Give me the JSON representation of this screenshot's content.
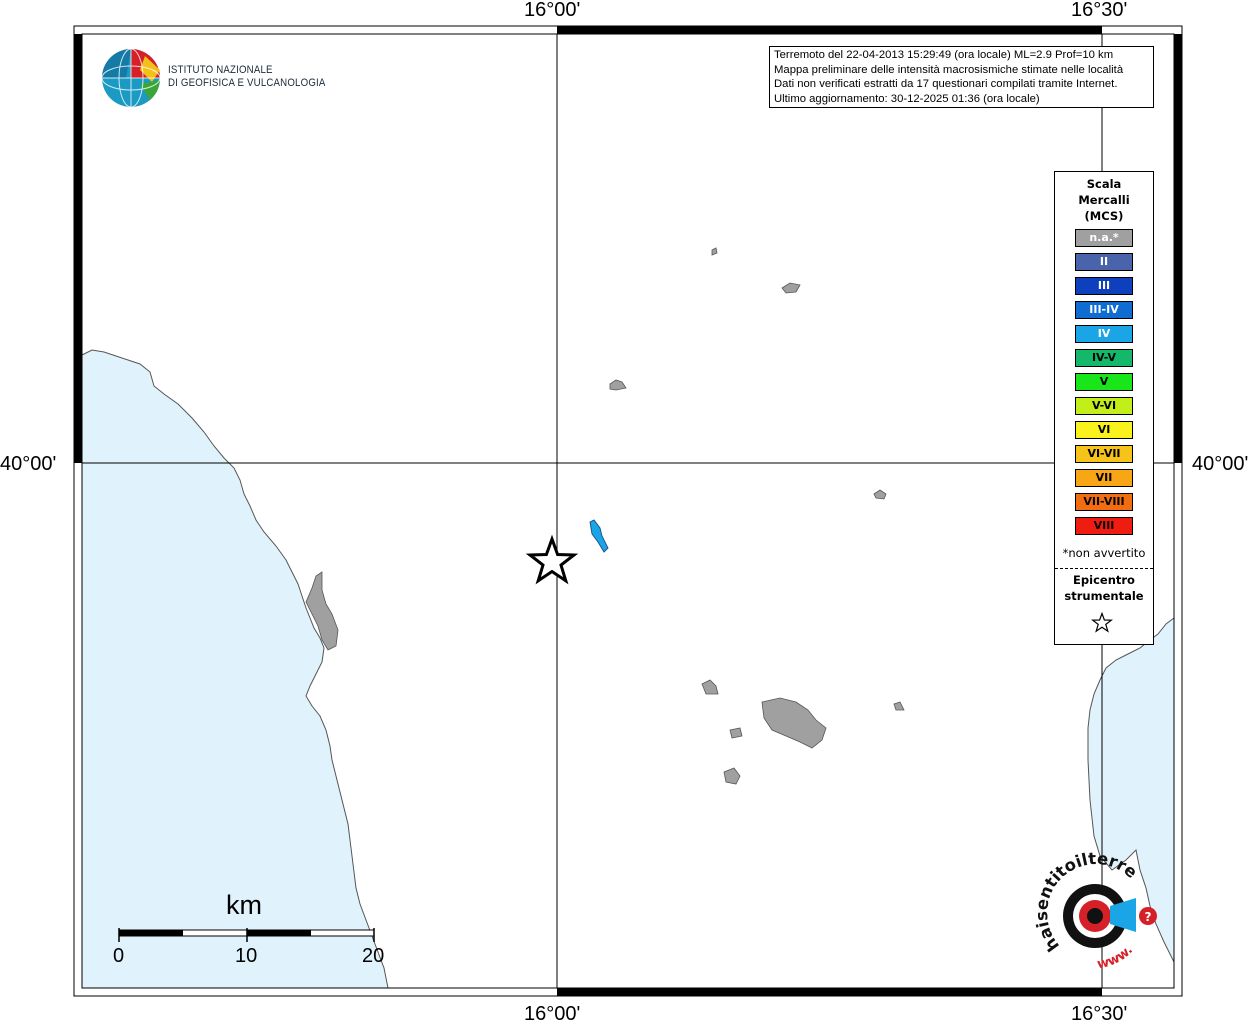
{
  "map": {
    "graticule": {
      "lon_labels": [
        "16°00'",
        "16°30'"
      ],
      "lat_labels": [
        "40°00'"
      ]
    },
    "colors": {
      "sea": "#e0f3fc",
      "land_felt": "#a0a0a0",
      "coast": "#444444",
      "frame": "#000000"
    }
  },
  "info": {
    "lines": [
      "Terremoto del 22-04-2013 15:29:49 (ora locale) ML=2.9 Prof=10 km",
      "Mappa preliminare delle intensità macrosismiche stimate nelle località",
      "Dati non verificati estratti da 17 questionari compilati tramite Internet.",
      "Ultimo aggiornamento: 30-12-2025 01:36 (ora locale)"
    ]
  },
  "logo": {
    "line1": "ISTITUTO NAZIONALE",
    "line2": "DI GEOFISICA E VULCANOLOGIA",
    "icon": "ingv-globe-icon"
  },
  "legend": {
    "title": [
      "Scala",
      "Mercalli",
      "(MCS)"
    ],
    "items": [
      {
        "label": "n.a.*",
        "color": "#a0a0a0"
      },
      {
        "label": "II",
        "color": "#4a64ac"
      },
      {
        "label": "III",
        "color": "#0e3fbd"
      },
      {
        "label": "III-IV",
        "color": "#0f6dd2"
      },
      {
        "label": "IV",
        "color": "#1aa5e6"
      },
      {
        "label": "IV-V",
        "color": "#13b86a"
      },
      {
        "label": "V",
        "color": "#19e619"
      },
      {
        "label": "V-VI",
        "color": "#c2ef19"
      },
      {
        "label": "VI",
        "color": "#f9f21c"
      },
      {
        "label": "VI-VII",
        "color": "#f5c319"
      },
      {
        "label": "VII",
        "color": "#f8a516"
      },
      {
        "label": "VII-VIII",
        "color": "#f26d11"
      },
      {
        "label": "VIII",
        "color": "#f01c12"
      }
    ],
    "note": "*non avvertito",
    "epicenter_title": [
      "Epicentro",
      "strumentale"
    ],
    "epicenter_icon": "star-icon"
  },
  "scalebar": {
    "title": "km",
    "labels": [
      "0",
      "10",
      "20"
    ]
  },
  "badge": {
    "text": "haisentitoilterremoto.it",
    "www": "www.",
    "icon": "hai-sentito-il-terremoto-logo-icon"
  }
}
